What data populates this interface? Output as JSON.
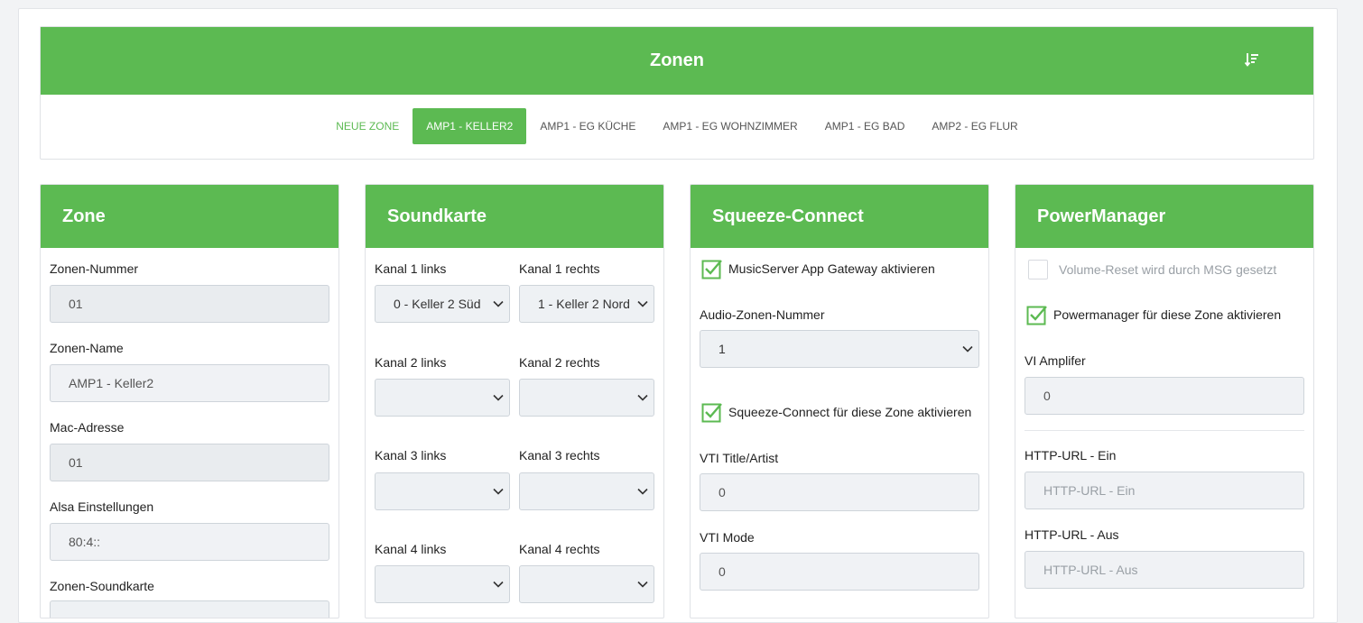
{
  "zones": {
    "title": "Zonen",
    "tabs": [
      {
        "label": "NEUE ZONE"
      },
      {
        "label": "AMP1 - KELLER2"
      },
      {
        "label": "AMP1 - EG KÜCHE"
      },
      {
        "label": "AMP1 - EG WOHNZIMMER"
      },
      {
        "label": "AMP1 - EG BAD"
      },
      {
        "label": "AMP2 - EG FLUR"
      }
    ]
  },
  "zone_panel": {
    "title": "Zone",
    "number_label": "Zonen-Nummer",
    "number_value": "01",
    "name_label": "Zonen-Name",
    "name_value": "AMP1 - Keller2",
    "mac_label": "Mac-Adresse",
    "mac_value": "01",
    "alsa_label": "Alsa Einstellungen",
    "alsa_value": "80:4::",
    "soundcard_label": "Zonen-Soundkarte"
  },
  "soundcard_panel": {
    "title": "Soundkarte",
    "k1l_label": "Kanal 1 links",
    "k1l_value": "0 - Keller 2 Süd",
    "k1r_label": "Kanal 1 rechts",
    "k1r_value": "1 - Keller 2 Nord",
    "k2l_label": "Kanal 2 links",
    "k2r_label": "Kanal 2 rechts",
    "k3l_label": "Kanal 3 links",
    "k3r_label": "Kanal 3 rechts",
    "k4l_label": "Kanal 4 links",
    "k4r_label": "Kanal 4 rechts"
  },
  "squeeze_panel": {
    "title": "Squeeze-Connect",
    "gateway_label": "MusicServer App Gateway aktivieren",
    "audio_zone_label": "Audio-Zonen-Nummer",
    "audio_zone_value": "1",
    "squeeze_enable_label": "Squeeze-Connect für diese Zone aktivieren",
    "vti_title_label": "VTI Title/Artist",
    "vti_title_value": "0",
    "vti_mode_label": "VTI Mode",
    "vti_mode_value": "0"
  },
  "power_panel": {
    "title": "PowerManager",
    "volume_reset_label": "Volume-Reset wird durch MSG gesetzt",
    "pm_enable_label": "Powermanager für diese Zone aktivieren",
    "vi_label": "VI Amplifer",
    "vi_value": "0",
    "http_on_label": "HTTP-URL - Ein",
    "http_on_placeholder": "HTTP-URL - Ein",
    "http_off_label": "HTTP-URL - Aus",
    "http_off_placeholder": "HTTP-URL - Aus"
  },
  "colors": {
    "accent": "#5cba52"
  }
}
